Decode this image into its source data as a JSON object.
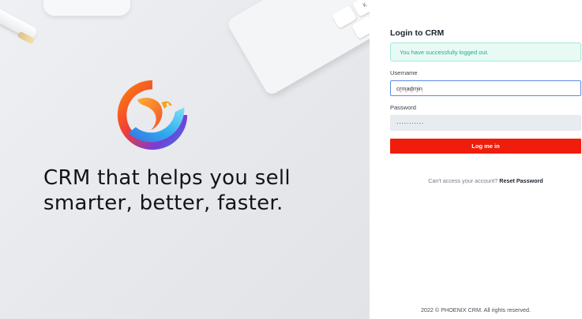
{
  "hero": {
    "tagline_line1": "CRM that helps you sell",
    "tagline_line2": "smarter, better, faster.",
    "logo_icon": "phoenix-logo-icon",
    "keyboard_key_label": "K"
  },
  "login": {
    "title": "Login to CRM",
    "alert_message": "You have successfully logged out.",
    "username_label": "Username",
    "username_value": "crmadmin",
    "password_label": "Password",
    "password_value": "···········",
    "submit_label": "Log me in",
    "forgot_text": "Can't access your account?",
    "reset_link": "Reset Password"
  },
  "footer": {
    "copyright": "2022 © PHOENIX CRM. All rights reserved."
  },
  "colors": {
    "primary_button": "#f01d0c",
    "alert_text": "#1eae8c",
    "alert_border": "#9ee8d9",
    "input_focus_border": "#5a8ce8"
  }
}
